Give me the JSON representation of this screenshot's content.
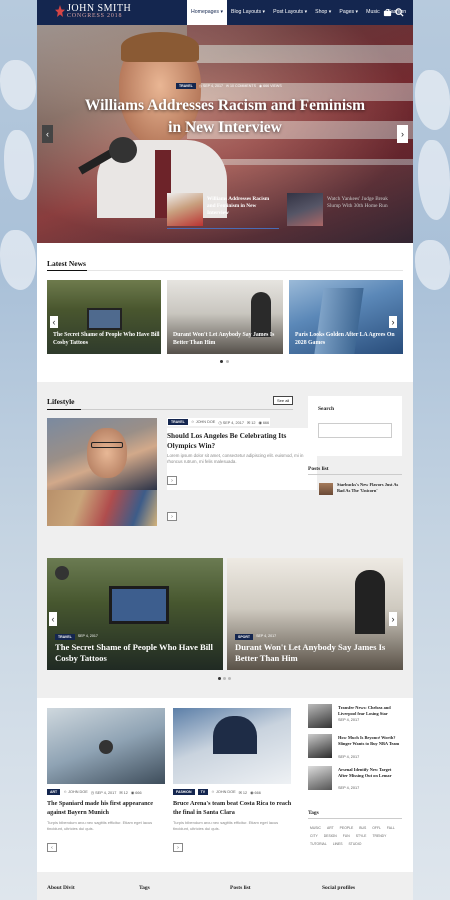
{
  "header": {
    "logo_name": "JOHN SMITH",
    "logo_sub": "CONGRESS 2018",
    "nav": [
      "Homepages",
      "Blog Layouts",
      "Post Layouts",
      "Shop",
      "Pages",
      "Music",
      "Fashion"
    ],
    "nav_suffix": [
      "▾",
      "▾",
      "▾",
      "▾",
      "▾",
      "",
      ""
    ],
    "cart_icon": "cart-icon",
    "search_icon": "search-icon"
  },
  "hero": {
    "category": "TRAVEL",
    "date": "SEP 4, 2017",
    "comments": "10 COMMENTS",
    "views": "666 VIEWS",
    "title": "Williams Addresses Racism and Feminism in New Interview",
    "thumbs": [
      {
        "title": "Williams Addresses Racism and Feminism in New Interview"
      },
      {
        "title": "Watch Yankees' Judge Break Slump With 30th Home Run"
      }
    ]
  },
  "latest": {
    "title": "Latest News",
    "cards": [
      "The Secret Shame of People Who Have Bill Cosby Tattoos",
      "Durant Won't Let Anybody Say James Is Better Than Him",
      "Paris Looks Golden After LA Agrees On 2028 Games"
    ]
  },
  "lifestyle": {
    "title": "Lifestyle",
    "see_all": "See all",
    "post": {
      "category": "TRAVEL",
      "author": "JOHN DOE",
      "date": "SEP 4, 2017",
      "comments": "12",
      "views": "666",
      "title": "Should Los Angeles Be Celebrating Its Olympics Win?",
      "excerpt": "Lorem ipsum dolor sit amet, consectetur adipiscing elit. euismod, mi in rhoncus rutrum, mi felis malesuada."
    }
  },
  "sidebar": {
    "search_title": "Search",
    "posts_list_title": "Posts list",
    "post": "Starbucks's New Flavors Just As Bad As The 'Unicorn'"
  },
  "big": {
    "cards": [
      {
        "category": "TRAVEL",
        "date": "SEP 4, 2017",
        "title": "The Secret Shame of People Who Have Bill Cosby Tattoos"
      },
      {
        "category": "SPORT",
        "date": "SEP 4, 2017",
        "title": "Durant Won't Let Anybody Say James Is Better Than Him"
      }
    ]
  },
  "grid": {
    "posts": [
      {
        "cats": [
          "ART"
        ],
        "author": "JOHN DOE",
        "date": "SEP 4, 2017",
        "comments": "12",
        "views": "666",
        "title": "The Spaniard made his first appearance against Bayern Munich",
        "excerpt": "Turpis bibendum arcu nec sagittis efficitur. Etiam eget lacus tincidunt, ultricies dui quis."
      },
      {
        "cats": [
          "FASHION",
          "TV"
        ],
        "author": "JOHN DOE",
        "date": "SEP 4, 2017",
        "comments": "12",
        "views": "666",
        "title": "Bruce Arena's team beat Costa Rica to reach the final in Santa Clara",
        "excerpt": "Turpis bibendum arcu nec sagittis efficitur. Etiam eget lacus tincidunt, ultricies dui quis."
      }
    ],
    "side": [
      {
        "title": "Transfer News: Chelsea and Liverpool fear Losing Star",
        "date": "SEP 4, 2017"
      },
      {
        "title": "How Much Is Beyoncé Worth? Slinger Wants to Buy NBA Team",
        "date": "SEP 4, 2017"
      },
      {
        "title": "Arsenal Identify New Target After Missing Out on Lemar",
        "date": "SEP 4, 2017"
      }
    ],
    "tags_title": "Tags",
    "tags": [
      "MUSIC",
      "ART",
      "PEOPLE",
      "BUS",
      "OFFL",
      "FALL",
      "CITY",
      "DESIGN",
      "FUN",
      "STYLE",
      "TRENDY",
      "TUTORIAL",
      "LINES",
      "STUDIO"
    ]
  },
  "footer": {
    "cols": [
      "About Divit",
      "Tags",
      "Posts list",
      "Social profiles"
    ]
  }
}
